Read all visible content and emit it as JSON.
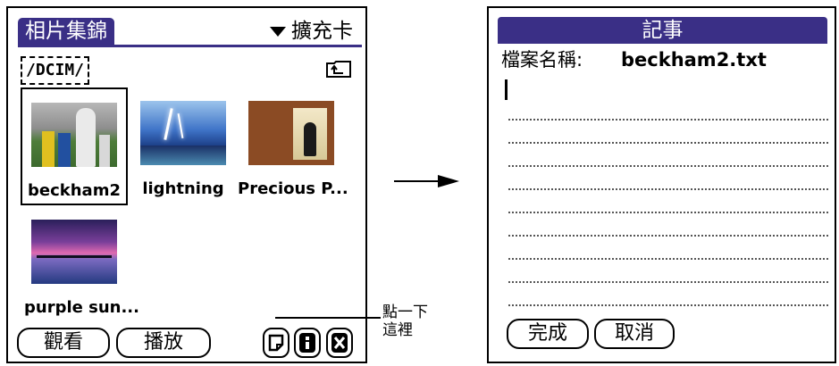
{
  "album": {
    "title": "相片集錦",
    "category": "擴充卡",
    "path": "/DCIM/",
    "photos": [
      {
        "label": "beckham2"
      },
      {
        "label": "lightning"
      },
      {
        "label": "Precious P..."
      },
      {
        "label": "purple sun..."
      }
    ],
    "buttons": {
      "view": "觀看",
      "play": "播放"
    }
  },
  "callout": {
    "line1": "點一下",
    "line2": "這裡"
  },
  "memo": {
    "title": "記事",
    "file_label": "檔案名稱:",
    "file_name": "beckham2.txt",
    "buttons": {
      "done": "完成",
      "cancel": "取消"
    }
  },
  "colors": {
    "title_bar": "#3a2f86"
  },
  "icons": [
    "triangle-down-icon",
    "folder-up-icon",
    "memo-icon",
    "info-icon",
    "delete-icon",
    "arrow-right-icon"
  ]
}
